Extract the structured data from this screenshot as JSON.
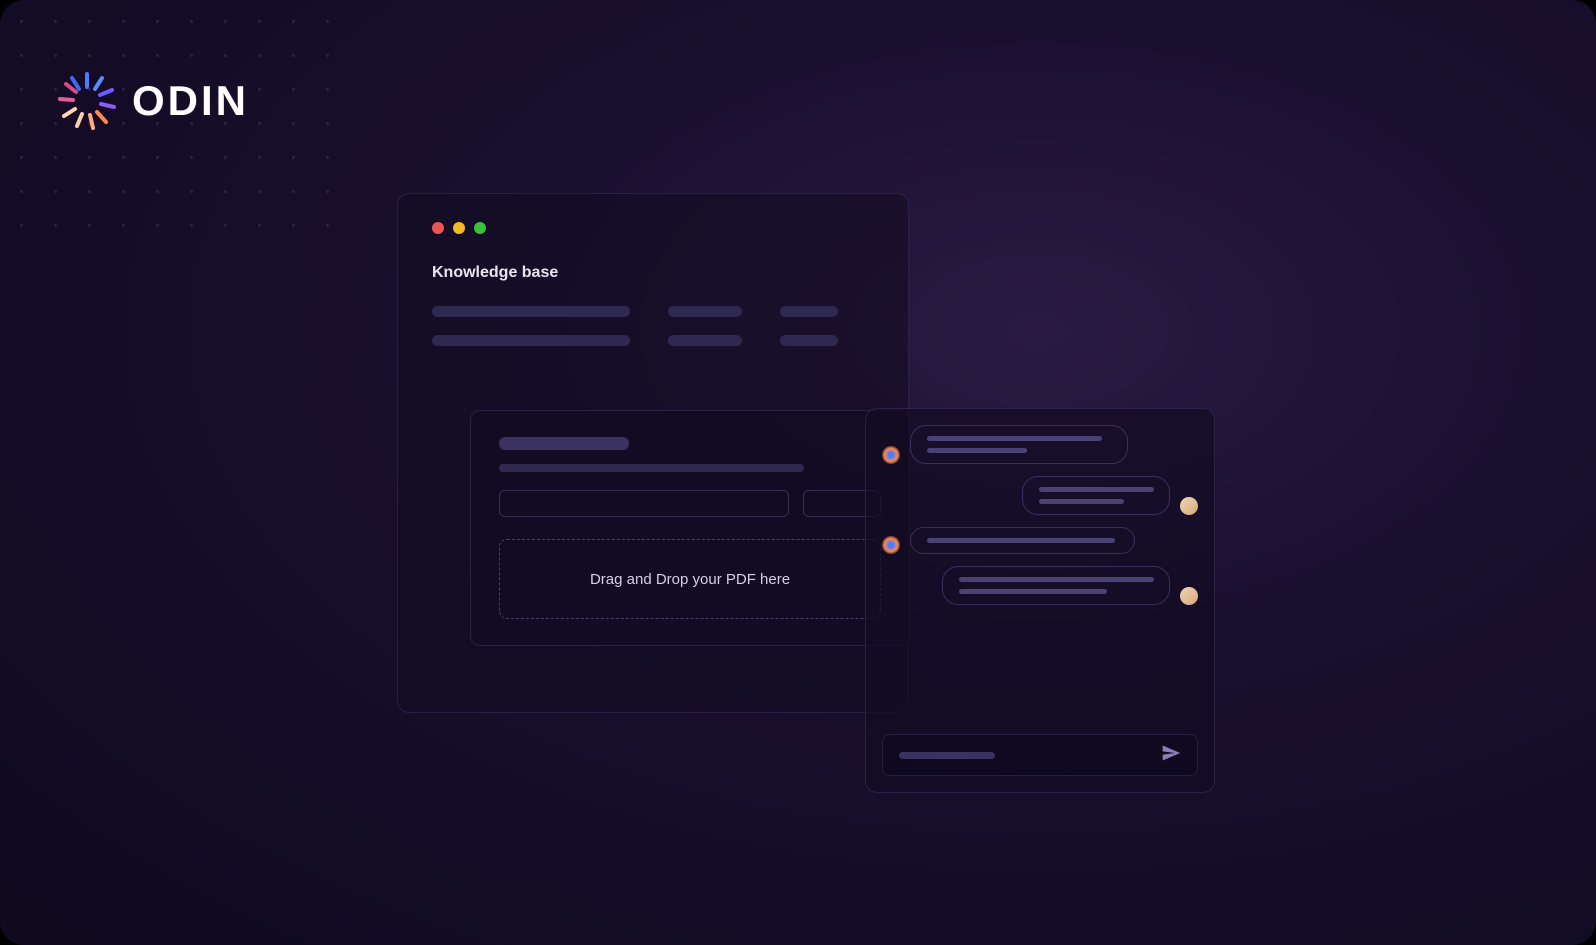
{
  "brand": {
    "name": "ODIN"
  },
  "knowledgeBase": {
    "title": "Knowledge base"
  },
  "upload": {
    "dropzone_text": "Drag and Drop your PDF here"
  }
}
